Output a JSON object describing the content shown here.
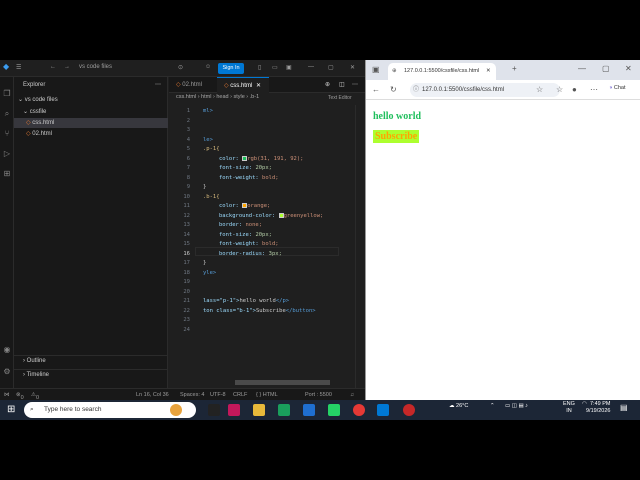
{
  "vscode": {
    "title": "vs code files",
    "sign_in": "Sign In",
    "explorer": "Explorer",
    "folder": "vs code files",
    "subfolder": "cssfile",
    "files": [
      "css.html",
      "02.html"
    ],
    "outline": "Outline",
    "timeline": "Timeline",
    "tabs": [
      "02.html",
      "css.html"
    ],
    "breadcrumb": "css.html  ›  html  ›  head  ›  style  ›  .b-1",
    "text_editor": "Text Editor",
    "line_numbers": [
      "1",
      "2",
      "3",
      "4",
      "5",
      "6",
      "7",
      "8",
      "9",
      "10",
      "11",
      "12",
      "13",
      "14",
      "15",
      "16",
      "17",
      "18",
      "19",
      "20",
      "21",
      "22",
      "23",
      "24"
    ],
    "code": {
      "l1": "ml>",
      "l4": "le>",
      "l5": ".p-1{",
      "l6a": "color: ",
      "l6b": "rgb(31, 191, 92);",
      "l7a": "font-size: ",
      "l7b": "20px;",
      "l8a": "font-weight: ",
      "l8b": "bold;",
      "l9": "}",
      "l10": ".b-1{",
      "l11a": "color: ",
      "l11b": "orange;",
      "l12a": "background-color: ",
      "l12b": "greenyellow;",
      "l13a": "border: ",
      "l13b": "none;",
      "l14a": "font-size: ",
      "l14b": "20px;",
      "l15a": "font-weight: ",
      "l15b": "bold;",
      "l16a": "border-radius: ",
      "l16b": "3px;",
      "l17": "}",
      "l18": "yle>",
      "l21a": "lass=\"p-1\">",
      "l21b": "hello world",
      "l21c": "</p>",
      "l22a": "ton class=\"b-1\">",
      "l22b": "Subscribe",
      "l22c": "</button>"
    },
    "status": {
      "errors": "0",
      "warnings": "0",
      "position": "Ln 16, Col 36",
      "spaces": "Spaces: 4",
      "encoding": "UTF-8",
      "eol": "CRLF",
      "language": "{ } HTML",
      "port": "Port : 5500"
    }
  },
  "browser": {
    "tab_title": "127.0.0.1:5500/cssfile/css.html",
    "url": "127.0.0.1:5500/cssfile/css.html",
    "chat": "Chat",
    "page": {
      "heading": "hello world",
      "button": "Subscribe"
    }
  },
  "taskbar": {
    "search_placeholder": "Type here to search",
    "weather": "26°C",
    "lang": "ENG",
    "region": "IN",
    "time": "7:49 PM",
    "date": "9/19/2026"
  }
}
